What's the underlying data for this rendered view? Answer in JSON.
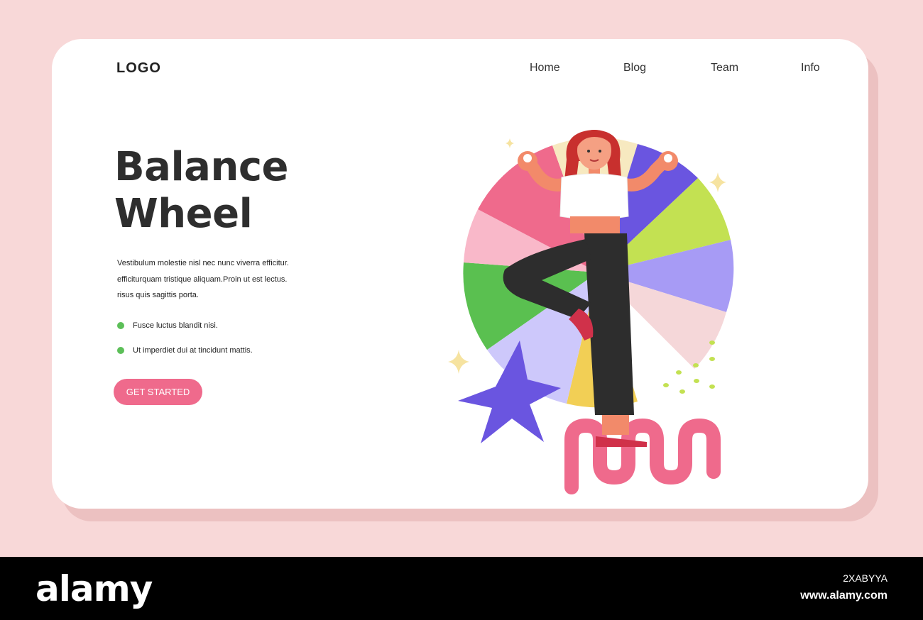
{
  "header": {
    "logo": "LOGO",
    "nav": [
      {
        "label": "Home"
      },
      {
        "label": "Blog"
      },
      {
        "label": "Team"
      },
      {
        "label": "Info"
      }
    ]
  },
  "hero": {
    "title_line1": "Balance",
    "title_line2": "Wheel",
    "body_lines": [
      "Vestibulum molestie nisl nec nunc viverra efficitur.",
      "efficiturquam tristique aliquam.Proin ut est lectus.",
      "risus quis sagittis porta."
    ],
    "bullets": [
      {
        "text": "Fusce luctus blandit nisi."
      },
      {
        "text": "Ut imperdiet dui at tincidunt mattis."
      }
    ],
    "cta_label": "GET STARTED"
  },
  "colors": {
    "page_bg": "#f8d8d8",
    "card_bg": "#ffffff",
    "accent_pink": "#ef6a8c",
    "bullet_green": "#5cbf58",
    "star_purple": "#6a55e0"
  },
  "footer": {
    "brand": "alamy",
    "image_id": "2XABYYA",
    "url": "www.alamy.com"
  }
}
